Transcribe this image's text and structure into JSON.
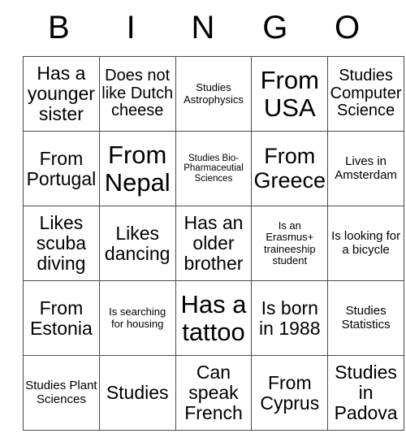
{
  "card": {
    "header_letters": [
      "B",
      "I",
      "N",
      "G",
      "O"
    ],
    "rows": [
      [
        {
          "text": "Has a younger sister",
          "size": "fs-l"
        },
        {
          "text": "Does not like Dutch cheese",
          "size": "fs-m"
        },
        {
          "text": "Studies Astrophysics",
          "size": "fs-xs"
        },
        {
          "text": "From USA",
          "size": "fs-xxl"
        },
        {
          "text": "Studies Computer Science",
          "size": "fs-m"
        }
      ],
      [
        {
          "text": "From Portugal",
          "size": "fs-l"
        },
        {
          "text": "From Nepal",
          "size": "fs-xxl"
        },
        {
          "text": "Studies Bio-Pharmaceutial Sciences",
          "size": "fs-xxs"
        },
        {
          "text": "From Greece",
          "size": "fs-xl"
        },
        {
          "text": "Lives in Amsterdam",
          "size": "fs-s"
        }
      ],
      [
        {
          "text": "Likes scuba diving",
          "size": "fs-l"
        },
        {
          "text": "Likes dancing",
          "size": "fs-l"
        },
        {
          "text": "Has an older brother",
          "size": "fs-l"
        },
        {
          "text": "Is an Erasmus+ traineeship student",
          "size": "fs-xs"
        },
        {
          "text": "Is looking for a bicycle",
          "size": "fs-s"
        }
      ],
      [
        {
          "text": "From Estonia",
          "size": "fs-l"
        },
        {
          "text": "Is searching for housing",
          "size": "fs-xs"
        },
        {
          "text": "Has a tattoo",
          "size": "fs-xxl"
        },
        {
          "text": "Is born in 1988",
          "size": "fs-l"
        },
        {
          "text": "Studies Statistics",
          "size": "fs-s"
        }
      ],
      [
        {
          "text": "Studies Plant Sciences",
          "size": "fs-s"
        },
        {
          "text": "Studies",
          "size": "fs-l"
        },
        {
          "text": "Can speak French",
          "size": "fs-l"
        },
        {
          "text": "From Cyprus",
          "size": "fs-l"
        },
        {
          "text": "Studies in Padova",
          "size": "fs-l"
        }
      ]
    ]
  },
  "colors": {
    "background": "#ffffff",
    "text": "#000000",
    "grid_line": "#4a4a4a"
  }
}
